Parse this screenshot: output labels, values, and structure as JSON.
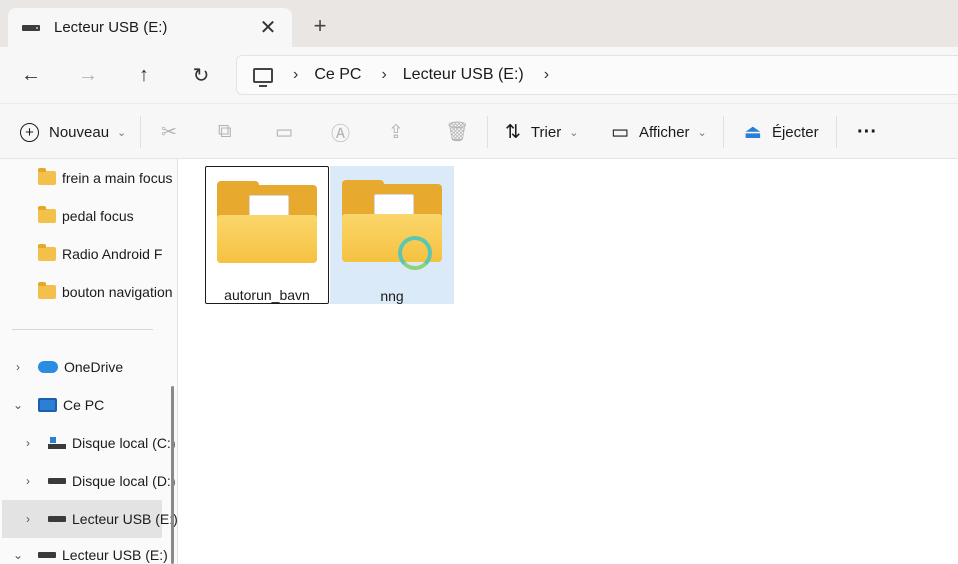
{
  "tab": {
    "title": "Lecteur USB (E:)",
    "close": "✕",
    "new_tab": "+"
  },
  "nav": {
    "back": "←",
    "forward": "→",
    "up": "↑",
    "refresh": "↻"
  },
  "address": {
    "separator": "›",
    "crumbs": [
      "Ce PC",
      "Lecteur USB (E:)"
    ],
    "trailing": "›"
  },
  "commands": {
    "new_label": "Nouveau",
    "sort_label": "Trier",
    "view_label": "Afficher",
    "eject_label": "Éjecter",
    "more": "···"
  },
  "sidebar": {
    "quick": [
      "frein a main focus",
      "pedal focus",
      "Radio Android F",
      "bouton navigation"
    ],
    "onedrive": "OneDrive",
    "this_pc": "Ce PC",
    "drives": [
      "Disque local (C:)",
      "Disque local (D:)",
      "Lecteur USB (E:)"
    ],
    "usb_root": "Lecteur USB (E:)"
  },
  "content": {
    "items": [
      {
        "name": "autorun_bavn"
      },
      {
        "name": "nng"
      }
    ]
  },
  "colors": {
    "folder": "#f5c241",
    "selection": "#dbeaf8",
    "accent": "#2a7fd4"
  }
}
